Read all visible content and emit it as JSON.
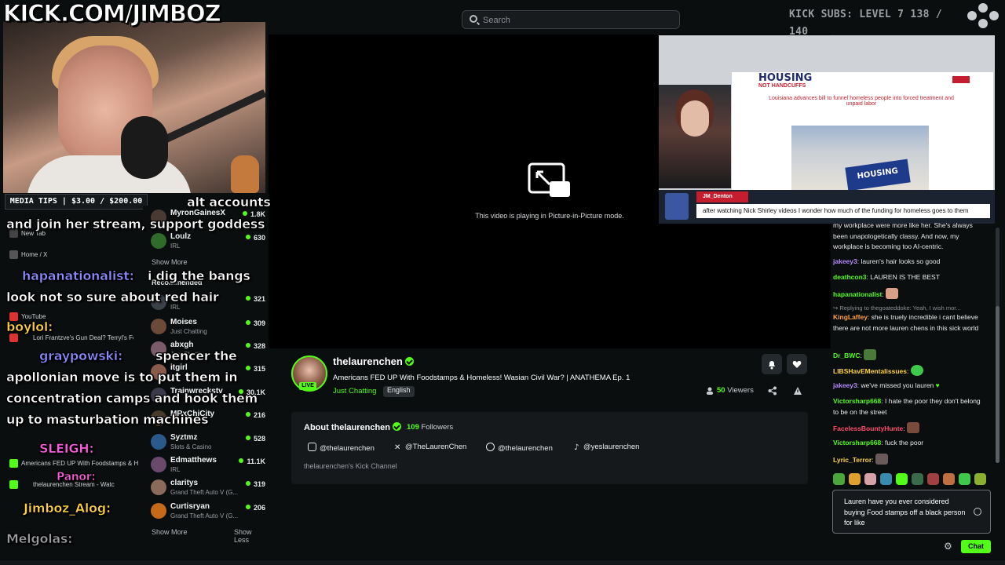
{
  "overlay": {
    "brand": "KICK.COM/JIMBOZ",
    "subs": "KICK SUBS: LEVEL 7 138 / 140",
    "media_tips": "MEDIA TIPS | $3.00 / $200.00",
    "chat_lines": [
      {
        "text": "alt accounts"
      },
      {
        "text": "and join her stream, support goddess"
      },
      {
        "user": "hapanationalist:",
        "text": "i dig the bangs"
      },
      {
        "text": "look not so sure about red hair"
      },
      {
        "user": "boylol:"
      },
      {
        "user": "graypowski:",
        "text": "spencer the"
      },
      {
        "text": "apollonian move is to put them in"
      },
      {
        "text": "concentration camps and hook them"
      },
      {
        "text": "up to masturbation machines"
      },
      {
        "user": "SLEIGH:"
      },
      {
        "user": "Panor:"
      },
      {
        "user": "Jimboz_Alog:"
      },
      {
        "user": "Melgolas:"
      }
    ]
  },
  "browser_tabs": [
    "New Tab",
    "Home / X",
    "YouTube",
    "Lori Frantzve's Gun Deal? Terryl's Fo",
    "Americans FED UP With Foodstamps & H",
    "thelaurenchen Stream - Watc"
  ],
  "header": {
    "search_placeholder": "Search"
  },
  "sidebar": {
    "following": [
      {
        "name": "MyronGainesX",
        "category": "",
        "viewers": "1.8K"
      },
      {
        "name": "Loulz",
        "category": "IRL",
        "viewers": "630"
      }
    ],
    "show_more_1": "Show More",
    "recommended_label": "Recommended",
    "recommended": [
      {
        "name": "",
        "category": "IRL",
        "viewers": "321"
      },
      {
        "name": "Moises",
        "category": "Just Chatting",
        "viewers": "309"
      },
      {
        "name": "abxgh",
        "category": "Just Chatting",
        "viewers": "328"
      },
      {
        "name": "itgirl",
        "category": "IRL",
        "viewers": "315"
      },
      {
        "name": "Trainwreckstv",
        "category": "",
        "viewers": "30.1K"
      },
      {
        "name": "MRxChiCity",
        "category": "",
        "viewers": "216"
      },
      {
        "name": "Syztmz",
        "category": "Slots & Casino",
        "viewers": "528"
      },
      {
        "name": "Edmatthews",
        "category": "IRL",
        "viewers": "11.1K"
      },
      {
        "name": "claritys",
        "category": "Grand Theft Auto V (G...",
        "viewers": "319"
      },
      {
        "name": "Curtisryan",
        "category": "Grand Theft Auto V (G...",
        "viewers": "206"
      }
    ],
    "show_more_2": "Show More",
    "show_less": "Show Less"
  },
  "video": {
    "pip_message": "This video is playing in Picture-in-Picture mode."
  },
  "channel": {
    "name": "thelaurenchen",
    "live_badge": "LIVE",
    "title": "Americans FED UP With Foodstamps & Homeless! Wasian Civil War? | ANATHEMA Ep. 1",
    "category": "Just Chatting",
    "language": "English",
    "viewers_count": "50",
    "viewers_label": "Viewers"
  },
  "about": {
    "title": "About thelaurenchen",
    "followers_count": "109",
    "followers_label": "Followers",
    "socials": [
      {
        "icon": "instagram-icon",
        "handle": "@thelaurenchen"
      },
      {
        "icon": "x-icon",
        "handle": "@TheLaurenChen"
      },
      {
        "icon": "facebook-icon",
        "handle": "@thelaurenchen"
      },
      {
        "icon": "tiktok-icon",
        "handle": "@yeslaurenchen"
      }
    ],
    "description": "thelaurenchen's Kick Channel"
  },
  "pip_window": {
    "site_title": "HOUSING",
    "site_subtitle": "NOT HANDCUFFS",
    "headline": "Louisiana advances bill to funnel homeless people into forced treatment and unpaid labor",
    "sign_text": "HOUSING",
    "chat_user": "JM_Denton",
    "chat_message": "after watching Nick Shirley videos I wonder how much of the funding for homeless goes to them"
  },
  "chat": {
    "messages": [
      {
        "user": "",
        "color": "#e9eaeb",
        "text": "my workplace were more like her. She's always been unapologetically classy. And now, my workplace is becoming too AI-centric."
      },
      {
        "user": "jakeey3",
        "color": "#b68cff",
        "text": "lauren's hair looks so good"
      },
      {
        "user": "deathcon3",
        "color": "#53fc18",
        "text": "LAUREN IS THE BEST"
      },
      {
        "user": "hapanationalist",
        "color": "#53fc18",
        "text": ""
      },
      {
        "reply": "Replying to thegoateddoke: Yeah, I wish mor..."
      },
      {
        "user": "KingLaffey",
        "color": "#ff9f40",
        "text": "she is truely incredible i cant believe there are not more lauren chens in this sick world"
      },
      {
        "user": "Dr_BWC",
        "color": "#53fc18",
        "text": ""
      },
      {
        "user": "LIBSHavEMentalissues",
        "color": "#ffd33d",
        "text": ""
      },
      {
        "user": "jakeey3",
        "color": "#b68cff",
        "text": "we've missed you lauren"
      },
      {
        "user": "Victorsharp668",
        "color": "#53fc18",
        "text": "I hate the poor they don't belong to be on the street"
      },
      {
        "user": "FacelessBountyHunte",
        "color": "#ff4d6d",
        "text": ""
      },
      {
        "user": "Victorsharp668",
        "color": "#53fc18",
        "text": "fuck the poor"
      },
      {
        "user": "Lyric_Terror",
        "color": "#ffd33d",
        "text": ""
      }
    ],
    "input_value": "Lauren have you ever considered buying Food stamps off a black person for like",
    "send_label": "Chat"
  },
  "colors": {
    "accent": "#53fc18",
    "background": "#0b0e0f",
    "panel": "#16191c"
  }
}
